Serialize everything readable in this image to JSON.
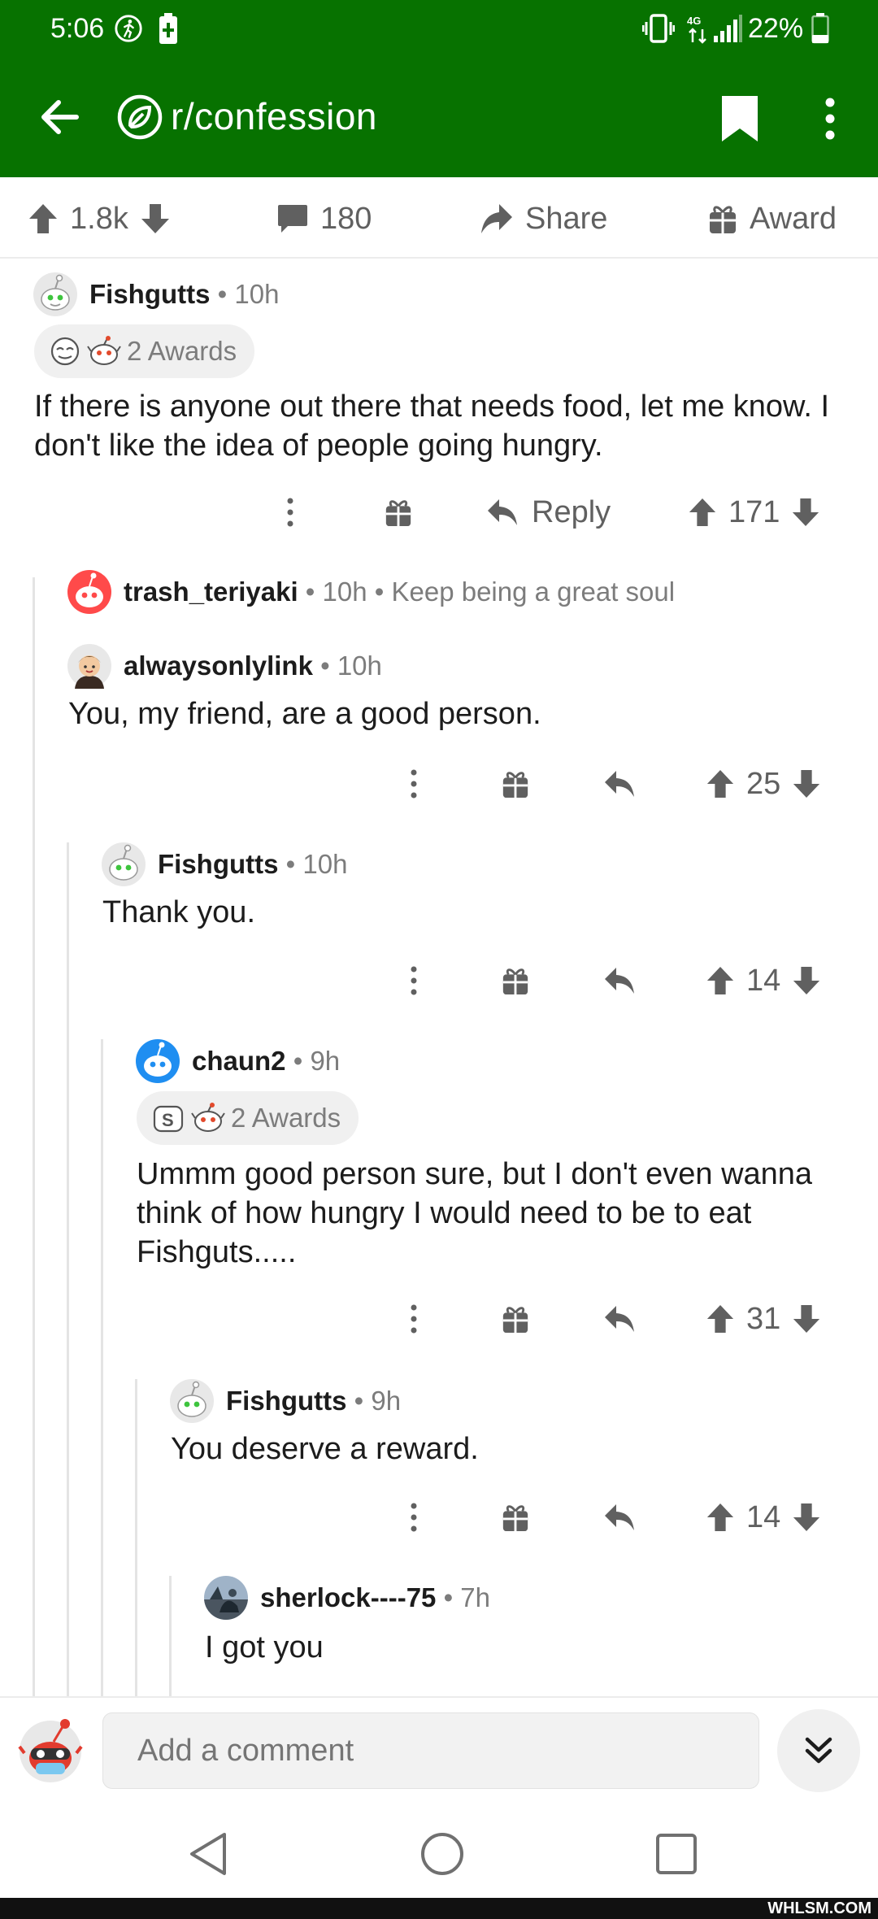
{
  "status_bar": {
    "time": "5:06",
    "battery": "22%",
    "signal_label": "4G"
  },
  "toolbar": {
    "subreddit": "r/confession"
  },
  "post_actions": {
    "score": "1.8k",
    "comments": "180",
    "share": "Share",
    "award": "Award"
  },
  "comments": [
    {
      "user": "Fishgutts",
      "time": "10h",
      "awards": "2 Awards",
      "body": "If there is anyone out there that needs food, let me know. I don't like the idea of people going hungry.",
      "reply_label": "Reply",
      "score": "171"
    },
    {
      "user": "trash_teriyaki",
      "time": "10h",
      "collapsed_text": "Keep being a great soul"
    },
    {
      "user": "alwaysonlylink",
      "time": "10h",
      "body": "You, my friend, are a good person.",
      "score": "25"
    },
    {
      "user": "Fishgutts",
      "time": "10h",
      "body": "Thank you.",
      "score": "14"
    },
    {
      "user": "chaun2",
      "time": "9h",
      "awards": "2 Awards",
      "body": "Ummm good person sure, but I don't even wanna think of how hungry I would need to be to eat Fishguts.....",
      "score": "31"
    },
    {
      "user": "Fishgutts",
      "time": "9h",
      "body": "You deserve a reward.",
      "score": "14"
    },
    {
      "user": "sherlock----75",
      "time": "7h",
      "body": "I got you"
    }
  ],
  "composer": {
    "placeholder": "Add a comment"
  },
  "watermark": "WHLSM.COM",
  "colors": {
    "header_green": "#077200",
    "text": "#1c1c1c",
    "meta": "#7c7c7c",
    "icon": "#606060"
  }
}
